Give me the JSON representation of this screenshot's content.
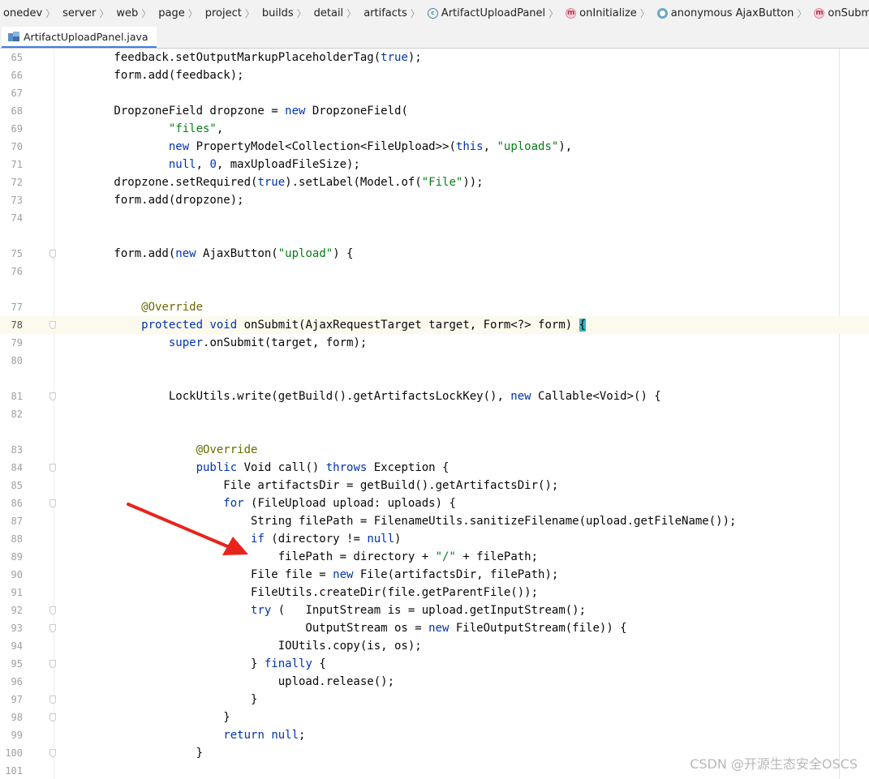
{
  "breadcrumb": [
    {
      "label": "onedev",
      "icon": ""
    },
    {
      "label": "server",
      "icon": ""
    },
    {
      "label": "web",
      "icon": ""
    },
    {
      "label": "page",
      "icon": ""
    },
    {
      "label": "project",
      "icon": ""
    },
    {
      "label": "builds",
      "icon": ""
    },
    {
      "label": "detail",
      "icon": ""
    },
    {
      "label": "artifacts",
      "icon": ""
    },
    {
      "label": "ArtifactUploadPanel",
      "icon": "class"
    },
    {
      "label": "onInitialize",
      "icon": "method"
    },
    {
      "label": "anonymous AjaxButton",
      "icon": "anon"
    },
    {
      "label": "onSubmit",
      "icon": "method"
    }
  ],
  "tab": {
    "label": "ArtifactUploadPanel.java"
  },
  "editor": {
    "current_line": "78",
    "lines": [
      {
        "n": "65",
        "t": "        feedback.setOutputMarkupPlaceholderTag(true);"
      },
      {
        "n": "66",
        "t": "        form.add(feedback);"
      },
      {
        "n": "67",
        "t": ""
      },
      {
        "n": "68",
        "t": "        DropzoneField dropzone = new DropzoneField("
      },
      {
        "n": "69",
        "t": "                \"files\","
      },
      {
        "n": "70",
        "t": "                new PropertyModel<Collection<FileUpload>>(this, \"uploads\"),"
      },
      {
        "n": "71",
        "t": "                null, 0, maxUploadFileSize);"
      },
      {
        "n": "72",
        "t": "        dropzone.setRequired(true).setLabel(Model.of(\"File\"));"
      },
      {
        "n": "73",
        "t": "        form.add(dropzone);"
      },
      {
        "n": "74",
        "t": ""
      },
      {
        "n": "",
        "t": ""
      },
      {
        "n": "75",
        "t": "        form.add(new AjaxButton(\"upload\") {",
        "fold": true
      },
      {
        "n": "76",
        "t": ""
      },
      {
        "n": "",
        "t": ""
      },
      {
        "n": "77",
        "t": "            @Override"
      },
      {
        "n": "78",
        "t": "            protected void onSubmit(AjaxRequestTarget target, Form<?> form) {",
        "fold": true
      },
      {
        "n": "79",
        "t": "                super.onSubmit(target, form);"
      },
      {
        "n": "80",
        "t": ""
      },
      {
        "n": "",
        "t": ""
      },
      {
        "n": "81",
        "t": "                LockUtils.write(getBuild().getArtifactsLockKey(), new Callable<Void>() {",
        "fold": true
      },
      {
        "n": "82",
        "t": ""
      },
      {
        "n": "",
        "t": ""
      },
      {
        "n": "83",
        "t": "                    @Override"
      },
      {
        "n": "84",
        "t": "                    public Void call() throws Exception {",
        "fold": true
      },
      {
        "n": "85",
        "t": "                        File artifactsDir = getBuild().getArtifactsDir();"
      },
      {
        "n": "86",
        "t": "                        for (FileUpload upload: uploads) {",
        "fold": true
      },
      {
        "n": "87",
        "t": "                            String filePath = FilenameUtils.sanitizeFilename(upload.getFileName());"
      },
      {
        "n": "88",
        "t": "                            if (directory != null)"
      },
      {
        "n": "89",
        "t": "                                filePath = directory + \"/\" + filePath;"
      },
      {
        "n": "90",
        "t": "                            File file = new File(artifactsDir, filePath);"
      },
      {
        "n": "91",
        "t": "                            FileUtils.createDir(file.getParentFile());"
      },
      {
        "n": "92",
        "t": "                            try (   InputStream is = upload.getInputStream();",
        "fold": true
      },
      {
        "n": "93",
        "t": "                                    OutputStream os = new FileOutputStream(file)) {",
        "fold": true
      },
      {
        "n": "94",
        "t": "                                IOUtils.copy(is, os);"
      },
      {
        "n": "95",
        "t": "                            } finally {",
        "fold": true
      },
      {
        "n": "96",
        "t": "                                upload.release();"
      },
      {
        "n": "97",
        "t": "                            }",
        "fold": true
      },
      {
        "n": "98",
        "t": "                        }",
        "fold": true
      },
      {
        "n": "99",
        "t": "                        return null;"
      },
      {
        "n": "100",
        "t": "                    }",
        "fold": true
      },
      {
        "n": "101",
        "t": ""
      }
    ]
  },
  "watermark": "CSDN @开源生态安全OSCS",
  "colors": {
    "keyword": "#0033b3",
    "string": "#067d17",
    "annotation": "#6a6a00",
    "arrow": "#e8231c",
    "caret": "#3ab0c4"
  }
}
